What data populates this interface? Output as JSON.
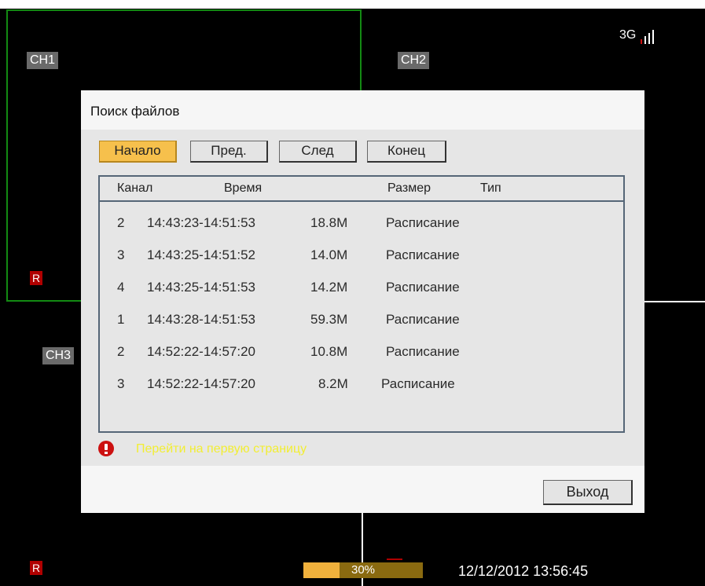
{
  "channels": {
    "ch1": "CH1",
    "ch2": "CH2",
    "ch3": "CH3"
  },
  "recording_badge": "R",
  "signal": {
    "network": "3G",
    "icon": "signal-bars-icon"
  },
  "dialog": {
    "title": "Поиск файлов",
    "nav": {
      "first": "Начало",
      "prev": "Пред.",
      "next": "След",
      "last": "Конец"
    },
    "columns": {
      "channel": "Канал",
      "time": "Время",
      "size": "Размер",
      "type": "Тип"
    },
    "files": [
      {
        "channel": "2",
        "time": "14:43:23-14:51:53",
        "size": "18.8M",
        "type": "Расписание"
      },
      {
        "channel": "3",
        "time": "14:43:25-14:51:52",
        "size": "14.0M",
        "type": "Расписание"
      },
      {
        "channel": "4",
        "time": "14:43:25-14:51:53",
        "size": "14.2M",
        "type": "Расписание"
      },
      {
        "channel": "1",
        "time": "14:43:28-14:51:53",
        "size": "59.3M",
        "type": "Расписание"
      },
      {
        "channel": "2",
        "time": "14:52:22-14:57:20",
        "size": "10.8M",
        "type": "Расписание"
      },
      {
        "channel": "3",
        "time": "14:52:22-14:57:20",
        "size": "8.2M",
        "type": "Расписание"
      }
    ],
    "hint": "Перейти на первую страницу",
    "exit": "Выход"
  },
  "status": {
    "progress_label": "30%",
    "progress_value": 0.3,
    "datetime": "12/12/2012 13:56:45"
  },
  "colors": {
    "accent": "#f6c04c",
    "selection": "#138a13",
    "hint": "#f2ee33",
    "rec": "#b00000"
  }
}
